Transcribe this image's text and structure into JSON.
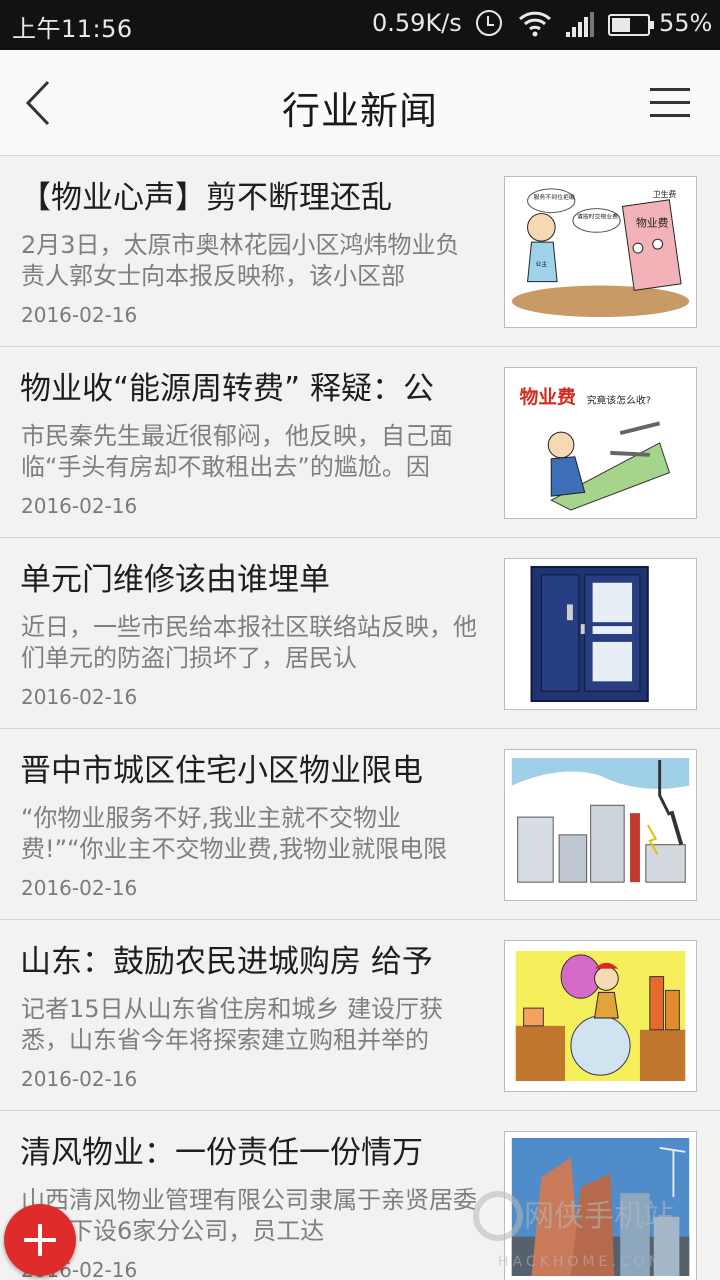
{
  "status_bar": {
    "time": "上午11:56",
    "speed": "0.59K/s",
    "battery_pct": "55%",
    "battery_level": 0.55,
    "icons": [
      "alarm-icon",
      "wifi-icon",
      "signal-icon",
      "battery-icon"
    ]
  },
  "header": {
    "title": "行业新闻",
    "back_icon": "chevron-left-icon",
    "menu_icon": "hamburger-menu-icon"
  },
  "news": [
    {
      "title": "【物业心声】剪不断理还乱",
      "summary": "2月3日，太原市奥林花园小区鸿炜物业负责人郭女士向本报反映称，该小区部",
      "date": "2016-02-16",
      "image_alt": "property-dispute-cartoon",
      "image_text": [
        "服务不到位拒缴",
        "请按时交物业费",
        "卫生费",
        "物业费",
        "业主"
      ]
    },
    {
      "title": "物业收“能源周转费” 释疑：公",
      "summary": "市民秦先生最近很郁闷，他反映，自己面临“手头有房却不敢租出去”的尴尬。因",
      "date": "2016-02-16",
      "image_alt": "property-fee-cartoon",
      "image_text": [
        "物业费",
        "究竟该怎么收?"
      ]
    },
    {
      "title": "单元门维修该由谁埋单",
      "summary": "近日，一些市民给本报社区联络站反映，他们单元的防盗门损坏了，居民认",
      "date": "2016-02-16",
      "image_alt": "security-door-photo",
      "image_text": []
    },
    {
      "title": "晋中市城区住宅小区物业限电",
      "summary": "“你物业服务不好,我业主就不交物业费!”“你业主不交物业费,我物业就限电限",
      "date": "2016-02-16",
      "image_alt": "power-restriction-illustration",
      "image_text": []
    },
    {
      "title": "山东：鼓励农民进城购房 给予",
      "summary": "记者15日从山东省住房和城乡 建设厅获悉，山东省今年将探索建立购租并举的",
      "date": "2016-02-16",
      "image_alt": "farmer-moving-to-city-cartoon",
      "image_text": []
    },
    {
      "title": "清风物业：一份责任一份情万",
      "summary": "山西清风物业管理有限公司隶属于亲贤居委会，下设6家分公司，员工达",
      "date": "2016-02-16",
      "image_alt": "high-rise-buildings-photo",
      "image_text": []
    }
  ],
  "fab": {
    "icon": "plus-icon",
    "color": "#e02b2b"
  },
  "watermark": {
    "brand": "网侠手机站",
    "site": "HACKHOME.COM"
  },
  "colors": {
    "accent": "#e02b2b",
    "statusbar": "#121212",
    "background": "#f2f2f2"
  }
}
